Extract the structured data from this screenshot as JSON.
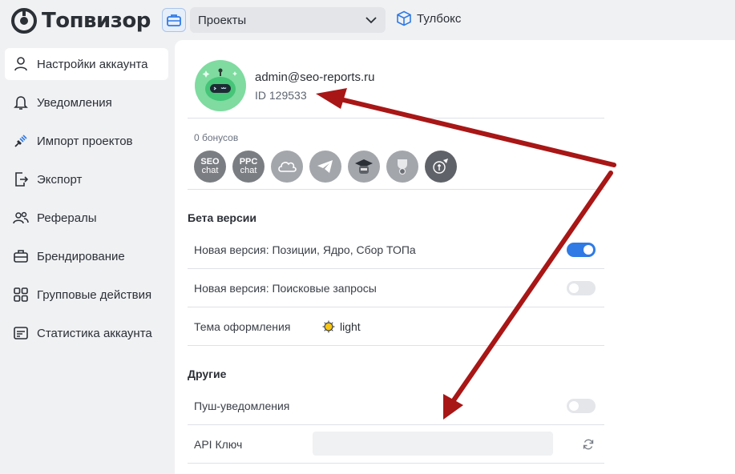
{
  "header": {
    "logo_text": "Топвизор",
    "project_select": "Проекты",
    "toolbox_label": "Тулбокс"
  },
  "sidebar": {
    "items": [
      {
        "label": "Настройки аккаунта",
        "icon": "user-icon",
        "active": true
      },
      {
        "label": "Уведомления",
        "icon": "bell-icon"
      },
      {
        "label": "Импорт проектов",
        "icon": "plug-icon"
      },
      {
        "label": "Экспорт",
        "icon": "export-icon"
      },
      {
        "label": "Рефералы",
        "icon": "users-icon"
      },
      {
        "label": "Брендирование",
        "icon": "briefcase-icon"
      },
      {
        "label": "Групповые действия",
        "icon": "grid-icon"
      },
      {
        "label": "Статистика аккаунта",
        "icon": "stats-icon"
      }
    ]
  },
  "profile": {
    "email": "admin@seo-reports.ru",
    "id": "ID 129533",
    "bonus": "0 бонусов",
    "badges": [
      {
        "line1": "SEO",
        "line2": "chat",
        "icon": "seo-chat-icon"
      },
      {
        "line1": "PPC",
        "line2": "chat",
        "icon": "ppc-chat-icon"
      },
      {
        "icon": "cloud-icon"
      },
      {
        "icon": "telegram-icon"
      },
      {
        "icon": "graduate-icon"
      },
      {
        "icon": "trophy-icon"
      },
      {
        "icon": "rocket-icon"
      }
    ]
  },
  "beta": {
    "title": "Бета версии",
    "rows": [
      {
        "label": "Новая версия: Позиции, Ядро, Сбор ТОПа",
        "enabled": true
      },
      {
        "label": "Новая версия: Поисковые запросы",
        "enabled": false
      }
    ],
    "theme_label": "Тема оформления",
    "theme_value": "light"
  },
  "other": {
    "title": "Другие",
    "push_label": "Пуш-уведомления",
    "push_enabled": false,
    "api_label": "API Ключ",
    "api_value": ""
  },
  "colors": {
    "accent": "#2f7ae5",
    "annotation_arrow": "#b01818",
    "avatar_bg": "#7fdba0"
  }
}
